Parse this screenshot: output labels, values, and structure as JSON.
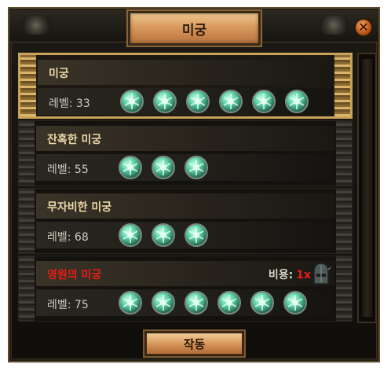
{
  "window": {
    "title": "미궁"
  },
  "colors": {
    "selected_border": "#c9a35a",
    "name_text": "#ead7a8",
    "uber_name": "#e81e14",
    "orb": "#5fd3a8"
  },
  "labryinths": [
    {
      "name": "미궁",
      "level_label": "레벨: 33",
      "orb_count": 6,
      "selected": true
    },
    {
      "name": "잔혹한 미궁",
      "level_label": "레벨: 55",
      "orb_count": 3,
      "selected": false
    },
    {
      "name": "무자비한 미궁",
      "level_label": "레벨: 68",
      "orb_count": 3,
      "selected": false
    },
    {
      "name": "영원의 미궁",
      "level_label": "레벨: 75",
      "orb_count": 6,
      "selected": false,
      "cost_label": "비용:",
      "cost_qty": "1x",
      "cost_icon": "offering-helmet-icon"
    }
  ],
  "actions": {
    "activate_label": "작동"
  },
  "icons": {
    "close": "close-x-icon",
    "orb": "green-orb-icon"
  }
}
